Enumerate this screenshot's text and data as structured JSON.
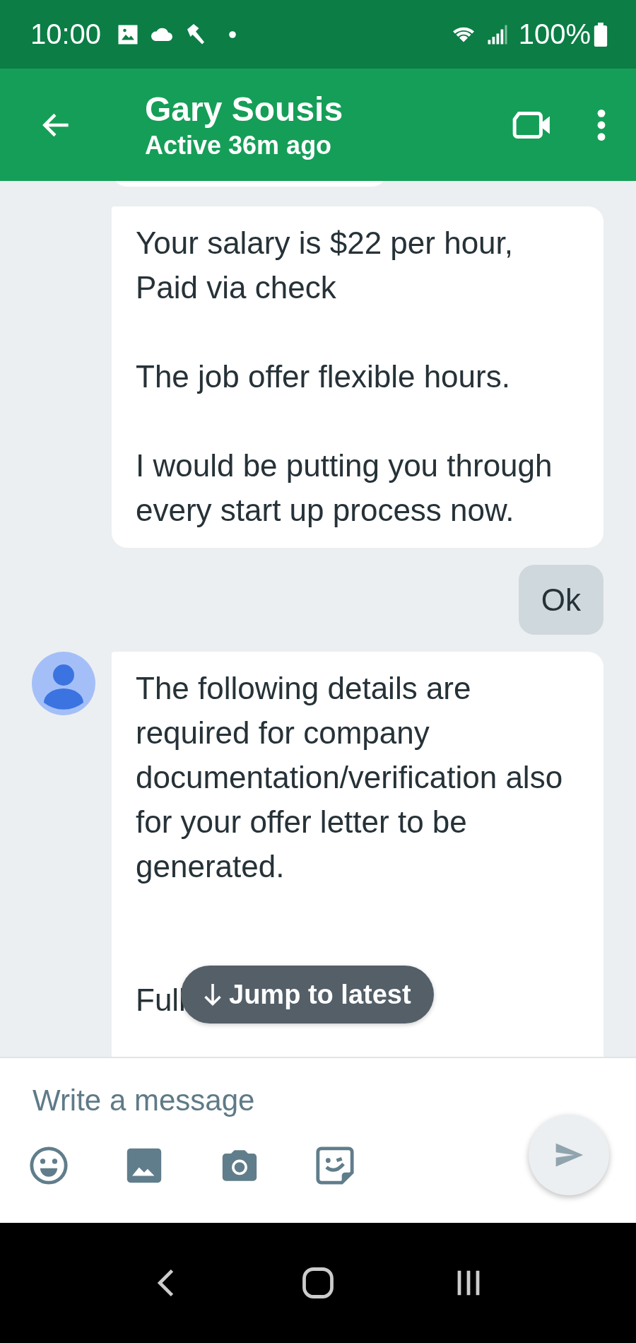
{
  "status_bar": {
    "time": "10:00",
    "battery": "100%"
  },
  "header": {
    "title": "Gary Sousis",
    "subtitle": "Active 36m ago"
  },
  "messages": [
    {
      "kind": "incoming",
      "avatar": false,
      "text": "Your salary is $22 per hour,\nPaid via check\n\nThe job offer flexible hours.\n\nI would be putting you through every start up process now."
    },
    {
      "kind": "outgoing",
      "text": "Ok"
    },
    {
      "kind": "incoming",
      "avatar": true,
      "text": "The following details are required for company documentation/verification also for your offer letter to be generated.\n\n\nFull"
    }
  ],
  "jump_button": {
    "label": "Jump to latest"
  },
  "composer": {
    "placeholder": "Write a message"
  }
}
